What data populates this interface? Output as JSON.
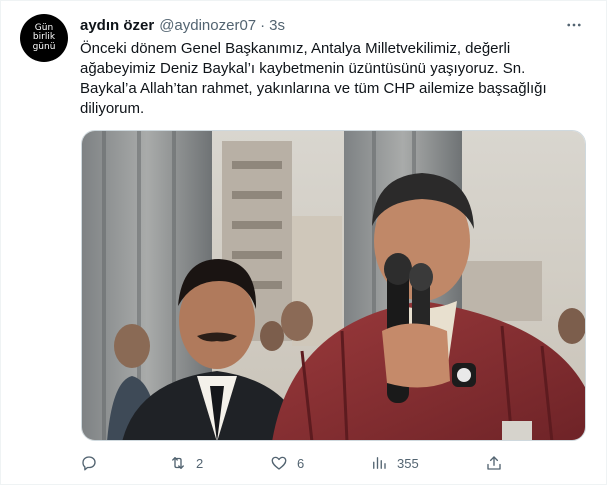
{
  "tweet": {
    "avatar_lines": [
      "Gün",
      "birlik",
      "günü"
    ],
    "display_name": "aydın özer",
    "handle": "@aydinozer07",
    "separator": "·",
    "time": "3s",
    "more_icon": "more-horizontal-icon",
    "text": "Önceki dönem Genel Başkanımız, Antalya Milletvekilimiz, değerli ağabeyimiz Deniz Baykal’ı kaybetmenin üzüntüsünü yaşıyoruz. Sn. Baykal’a Allah’tan rahmet, yakınlarına ve tüm CHP ailemize başsağlığı diliyorum."
  },
  "media": {
    "icon": "photo-icon"
  },
  "actions": {
    "reply": {
      "icon": "reply-icon",
      "count": ""
    },
    "retweet": {
      "icon": "retweet-icon",
      "count": "2"
    },
    "like": {
      "icon": "heart-icon",
      "count": "6"
    },
    "views": {
      "icon": "views-icon",
      "count": "355"
    },
    "share": {
      "icon": "share-icon",
      "count": ""
    }
  },
  "colors": {
    "text": "#0f1419",
    "secondary": "#536471",
    "border": "#cfd9de"
  }
}
